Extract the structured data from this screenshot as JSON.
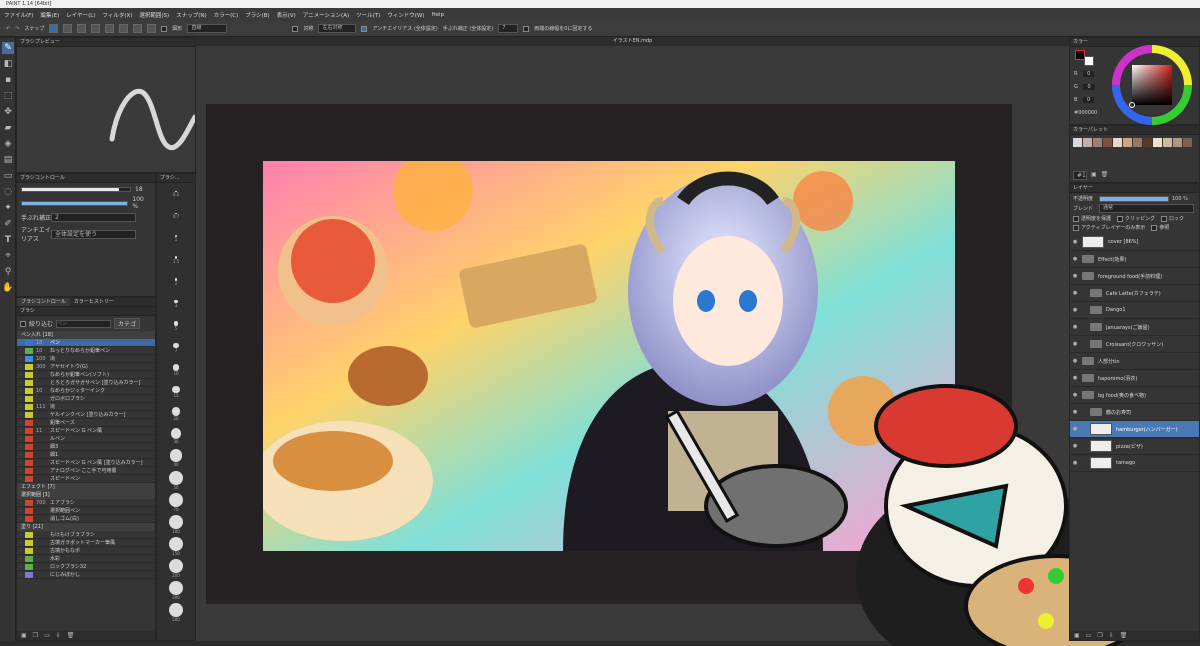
{
  "window": {
    "title": "PAINT 1.14 [64bit]"
  },
  "menu": [
    "ファイル(F)",
    "編集(E)",
    "レイヤー(L)",
    "フィルタ(X)",
    "選択範囲(S)",
    "スナップ(N)",
    "カラー(C)",
    "ブラシ(B)",
    "表示(V)",
    "アニメーション(A)",
    "ツール(T)",
    "ウィンドウ(W)",
    "Help"
  ],
  "toolbar": {
    "snap_label": "スナップ",
    "shape_label": "図形",
    "shape_value": "直線",
    "antialias_label": "アンチエイリアス (全体設定)",
    "correction_label": "手ぶれ補正 (全体設定)",
    "correction_value": "7",
    "reset_label": "両端の線幅を0に固定する",
    "symmetry_label": "対称",
    "symmetry_value": "左右対称"
  },
  "document": {
    "tab": "イラストEN.mdp"
  },
  "brush_preview": {
    "title": "ブラシプレビュー"
  },
  "brush_control": {
    "title": "ブラシコントロール",
    "size_value": "18",
    "opacity_value": "100 %",
    "stabilizer_label": "手ぶれ補正",
    "stabilizer_value": "2",
    "antialias_label": "アンチエイリアス",
    "antialias_value": "全体設定を使う",
    "size_fill": 0.9,
    "opacity_fill": 1.0
  },
  "brush_size_panel": {
    "title": "ブラシ...",
    "sizes": [
      "0.5",
      "0.7",
      "1",
      "1.5",
      "2",
      "3",
      "5",
      "7",
      "10",
      "15",
      "20",
      "30",
      "40",
      "50",
      "70",
      "100",
      "150",
      "200",
      "300",
      "500"
    ]
  },
  "brush_panel": {
    "tabs": [
      "ブラシコントロール",
      "カラーヒストリー"
    ],
    "title": "ブラシ",
    "filter_label": "絞り込む",
    "search_placeholder": "ペン",
    "category_button": "カテゴ",
    "groups": [
      {
        "name": "ペン入れ [18]",
        "items": [
          {
            "num": "18",
            "name": "ペン",
            "color": "#3b73c8",
            "selected": true
          },
          {
            "num": "10",
            "name": "ねっとりなめらか鉛筆ペン",
            "color": "#5ab04a"
          },
          {
            "num": "100",
            "name": "滝",
            "color": "#3b8de0"
          },
          {
            "num": "300",
            "name": "アヤセイトウ(G)",
            "color": "#c9c932"
          },
          {
            "num": "",
            "name": "なめらか鉛筆ペン(ソフト)",
            "color": "#c9c932"
          },
          {
            "num": "",
            "name": "とろとろガサガサペン [塗り込みカラー]",
            "color": "#c9c932"
          },
          {
            "num": "10",
            "name": "なめらかジッターインク",
            "color": "#c9c932"
          },
          {
            "num": "",
            "name": "ガロボロブラシ",
            "color": "#c9c932"
          },
          {
            "num": "111",
            "name": "滝",
            "color": "#c9c932"
          },
          {
            "num": "",
            "name": "ゲルインクペン [塗り込みカラー]",
            "color": "#c9c932"
          },
          {
            "num": "",
            "name": "鉛筆ペース",
            "color": "#d0452f"
          },
          {
            "num": "11",
            "name": "スピードペン G ペン風",
            "color": "#d0452f"
          },
          {
            "num": "",
            "name": "ルペン",
            "color": "#d0452f"
          },
          {
            "num": "",
            "name": "細3",
            "color": "#d0452f"
          },
          {
            "num": "",
            "name": "細1",
            "color": "#d0452f"
          },
          {
            "num": "",
            "name": "スピードペン G ペン風 [塗り込みカラー]",
            "color": "#d0452f"
          },
          {
            "num": "",
            "name": "アナログペン ここ手で可用書",
            "color": "#d0452f"
          },
          {
            "num": "",
            "name": "スピードペン",
            "color": "#d0452f"
          }
        ]
      },
      {
        "name": "エフェクト [7]",
        "items": []
      },
      {
        "name": "選択範囲 [3]",
        "items": [
          {
            "num": "700",
            "name": "エアブラシ",
            "color": "#d0452f"
          },
          {
            "num": "",
            "name": "選択範囲ペン",
            "color": "#d0452f"
          },
          {
            "num": "",
            "name": "消しゴム(白)",
            "color": "#d0452f"
          }
        ]
      },
      {
        "name": "塗り [21]",
        "items": [
          {
            "num": "",
            "name": "もけもけブラブラシ",
            "color": "#c9c932"
          },
          {
            "num": "",
            "name": "古墳ガラポットマーカー筆風",
            "color": "#c9c932"
          },
          {
            "num": "",
            "name": "古墳かもなポ",
            "color": "#c9c932"
          },
          {
            "num": "",
            "name": "水彩",
            "color": "#5ab04a"
          },
          {
            "num": "",
            "name": "ロックブラシ32",
            "color": "#5ab04a"
          },
          {
            "num": "",
            "name": "にじみぼかし",
            "color": "#7a7ad0"
          }
        ]
      }
    ]
  },
  "color_panel": {
    "title": "カラー",
    "r_label": "R",
    "g_label": "G",
    "b_label": "B",
    "r_value": "0",
    "g_value": "0",
    "b_value": "0",
    "hex": "#000000"
  },
  "palette_panel": {
    "title": "カラーパレット",
    "swatches": [
      "#d8d8d8",
      "#c0b0a8",
      "#a08070",
      "#7a5040",
      "#e8d8c8",
      "#c8a888",
      "#9a7860",
      "#5a3828",
      "#f0e0d0",
      "#d0b8a0",
      "#b09880",
      "#806050"
    ]
  },
  "layer_panel": {
    "title": "レイヤー",
    "opacity_label": "不透明度",
    "opacity_value": "100 %",
    "opacity_fill": 1.0,
    "blend_label": "ブレンド",
    "blend_value": "通常",
    "options": [
      "透明度を保護",
      "クリッピング",
      "ロック",
      "アクティブレイヤーのみ表示",
      "参照"
    ],
    "layers": [
      {
        "name": "cover [86%]",
        "type": "layer"
      },
      {
        "name": "Effect(効果)",
        "type": "folder"
      },
      {
        "name": "foreground food(手前料理)",
        "type": "folder"
      },
      {
        "name": "Cafe Latte(カフェラテ)",
        "type": "folder",
        "indent": 1
      },
      {
        "name": "Dango1",
        "type": "folder",
        "indent": 1
      },
      {
        "name": "Januarays(ご飯屋)",
        "type": "folder",
        "indent": 1
      },
      {
        "name": "Croissant(クロワッサン)",
        "type": "folder",
        "indent": 1
      },
      {
        "name": "人部分tin",
        "type": "folder"
      },
      {
        "name": "haporomo(羽衣)",
        "type": "folder"
      },
      {
        "name": "bg food(奥の食べ物)",
        "type": "folder"
      },
      {
        "name": "鶴のお寿司",
        "type": "folder",
        "indent": 1
      },
      {
        "name": "hamburger(ハンバーガー)",
        "type": "layer",
        "indent": 1,
        "selected": true
      },
      {
        "name": "pizza(ピザ)",
        "type": "layer",
        "indent": 1
      },
      {
        "name": "tamago",
        "type": "layer",
        "indent": 1
      }
    ]
  },
  "colors": {
    "accent": "#3e6aa7",
    "panel_bg": "#353535",
    "canvas_bg": "#3a3a3a"
  }
}
